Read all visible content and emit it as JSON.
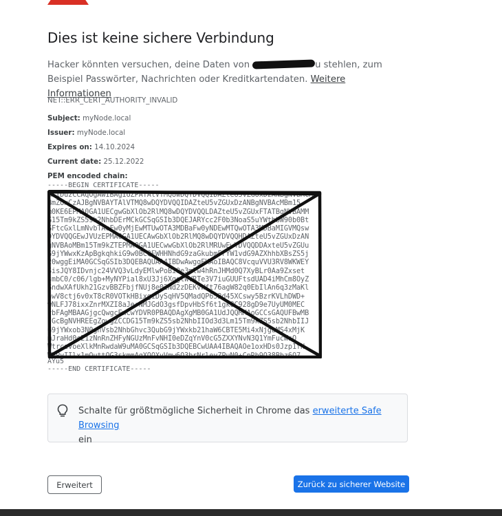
{
  "page": {
    "title": "Dies ist keine sichere Verbindung",
    "description_before": "Hacker könnten versuchen, deine Daten von",
    "description_after": "u stehlen, zum Beispiel Passwörter, Nachrichten oder Kreditkartendaten.",
    "learn_more_link": "Weitere Informationen",
    "error_code": "NET::ERR_CERT_AUTHORITY_INVALID"
  },
  "cert": {
    "subject_label": "Subject:",
    "subject_value": "myNode.local",
    "issuer_label": "Issuer:",
    "issuer_value": "myNode.local",
    "expires_label": "Expires on:",
    "expires_value": "14.10.2024",
    "current_label": "Current date:",
    "current_value": "25.12.2022",
    "pem_label": "PEM encoded chain:",
    "pem_begin": "-----BEGIN CERTIFICATE-----",
    "pem_lines": [
      "MIIDuzCCAqOgAwIBAgIUZPATAlVTMQ8wDQYDVQQIDAZteU5vZGUxDzANBgNVBAcM",
      "BmZUxCzAJBgNVBAYTAlVTMQ8wDQYDVQQIDAZteU5vZGUxDzANBgNVBAcMBm15",
      "m0KE6EPMA0GA1UECgwGbXlOb2RlMQ8wDQYDVQQLDAZteU5vZGUxFTATBgNVBAMM",
      "G15Tm9kZS5sb2NhbDErMCkGCSqGSIb3DQEJARYcc2F0b3NoaS5uYWthbW90b0Bt",
      "GFtcGxlLmNvbTAeFw0yMjEwMTUwOTA3MDBaFw0yNDEwMTQwOTA3MDBaMIGVMQsw",
      "DYDVQQGEwJVUzEPMA0GA1UECAwGbXlOb2RlMQ8wDQYDVQQHDAZteU5vZGUxDzAN",
      "gNVBAoMBm15Tm9kZTEPMA0GA1UECwwGbXlOb2RlMRUwEwYDVQQDDAxteU5vZGUu",
      "G9jYWwxKzApBgkqhkiG9w0BCQEWHHNhdG9zaGkubmFrYW1vdG9AZXhhbXBsZS5j",
      "20wggEiMA0GCSqGSIb3DQEBAQUAA4IBDwAwggEKAoIBAQC8VcquVVU3RV8WKWEY",
      "SisJQY8IDvnjc24VVQ3vLdyEMlwPoBi0e3mlw4hRnJHMd0Q7XyBLr0Aa9Zxset",
      "smbC0/c06/lgb+MyNYPial8xU3Jj6XggtWVRTe3V7iuGUUFtsdUAD4iMhCm8OyZ",
      "GndwXAfUkh21GzvBBZFbjfNUj8e02Nd2zDEKvWft76agW82q0EbIlAn6q3zMaKl",
      "hwV8ctj6v0xT8cR0VOTkHBixgiDySqHV5QMadQP652d45XCswy5BzrKVLhDWD+",
      "wNLFJ78ixxZnrMXZI8aJerNMJGdO3gsfDpvHbSf6t1gk8C928gD9e7UyUM0MEC",
      "vbFAgMBAAGjgcQwgcEwCwYDVR0PBAQDAgXgMB0GA1UdJQQMMAoGCCsGAQUFBwMB",
      "IGcBgNVHREEgZowgZCCDG15Tm9kZS5sb2NhbIIOd3d3Lm15Tm9kZS5sb2NhbIIJ",
      "G9jYWxob3N0ghVsb2NhbGhvc3QubG9jYWxkb21haW6CBTE5Mi4xNjguMS4xMjK",
      "mJraHd0c21zNnRnZHFyNGUzMnFvNHI0eDZqYnV0cG5ZXXYNvN3Q1YmFucWsO",
      "WtrczVoeXlkMnRwdaW9uMA0GCSqGSIb3DQEBCwUAA4IBAQAOe1oxHDs0Jzp1fN",
      "WDPyIIlx1mOuttOG3skmmAgXOQXyVmw6Q3brNrleyZPuN0+CpRb9O38Bbz6O7",
      "FRkO2MxO8+IIYeUvM3cEfGZMD8eGNSWLcXZBnChYsTv+CfNGJAaKhNChY8QQ8jN",
      "sH5qMxcubjhkl+/uG/UFr99yYTHUUcY1hATuTggg3Y1pwZchGfqwOBN05gydjd",
      "n4KQS4FzqZHW4E+k98gINuhsKiRhI4Aetr7bqME51SOeKZeVJOQSE4W/n0KXA",
      "BcAMVWgh5Cq3ghFbIn8LKsGnAzoZdCE6GIVQBaqFX0GzXc9AvnQI1jGHnJI",
      "AYu5"
    ],
    "pem_end": "-----END CERTIFICATE-----"
  },
  "info": {
    "text_before": "Schalte für größtmögliche Sicherheit in Chrome das",
    "link": "erweiterte Safe Browsing",
    "text_after": "ein"
  },
  "buttons": {
    "advanced": "Erweitert",
    "back": "Zurück zu sicherer Website"
  },
  "colors": {
    "danger": "#d93025",
    "primary": "#1a73e8",
    "text": "#202124",
    "secondary_text": "#5f6368"
  }
}
